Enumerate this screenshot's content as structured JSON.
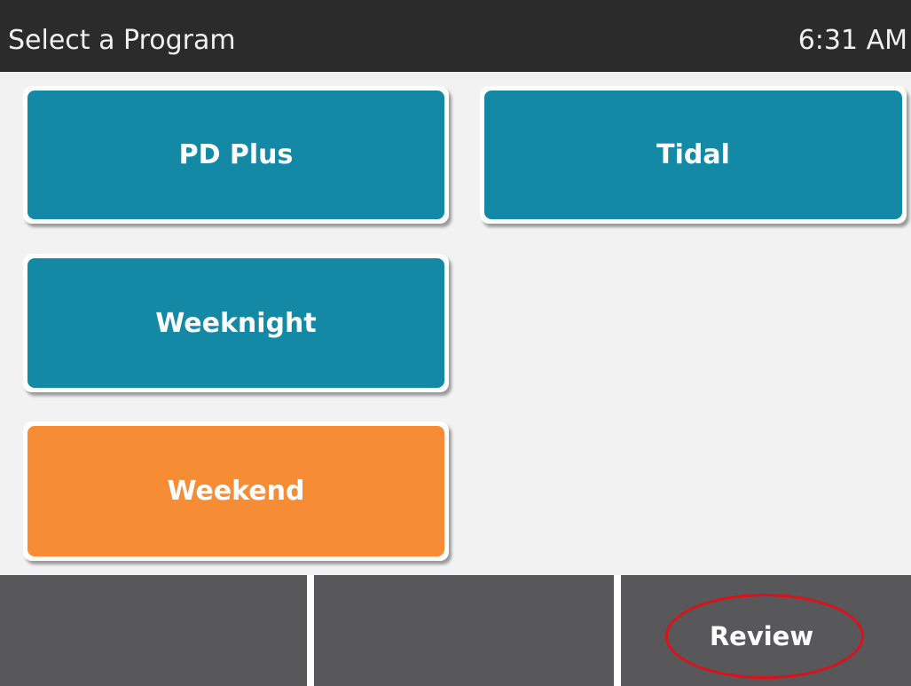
{
  "header": {
    "title": "Select a Program",
    "time": "6:31 AM"
  },
  "programs": [
    {
      "label": "PD Plus",
      "color": "#1489a6"
    },
    {
      "label": "Tidal",
      "color": "#1489a6"
    },
    {
      "label": "Weeknight",
      "color": "#1489a6"
    },
    {
      "label": "Weekend",
      "color": "#f68d35"
    }
  ],
  "footer": {
    "button_1_label": "",
    "button_2_label": "",
    "review_label": "Review"
  },
  "colors": {
    "header_bg": "#2b2b2b",
    "program_teal": "#1489a6",
    "program_selected_orange": "#f68d35",
    "footer_button_bg": "#58585a",
    "annotation_ring": "#e0101a"
  }
}
